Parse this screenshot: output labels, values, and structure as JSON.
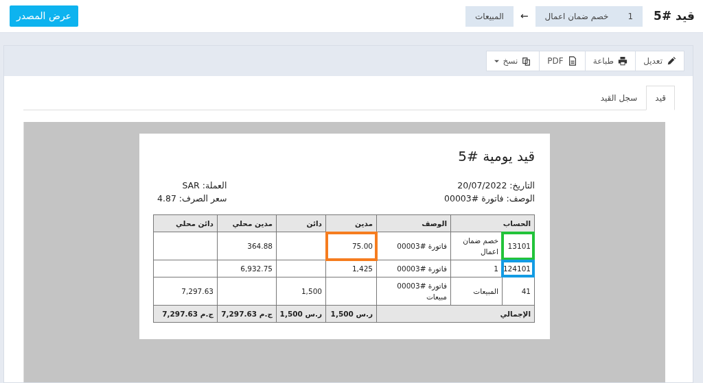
{
  "header": {
    "title": "قيد #5",
    "breadcrumb": [
      {
        "kind": "chip",
        "text": "1"
      },
      {
        "kind": "chip",
        "text": "خصم ضمان اعمال"
      },
      {
        "kind": "arrow",
        "text": "←"
      },
      {
        "kind": "chip",
        "text": "المبيعات"
      }
    ],
    "source_button": "عرض المصدر"
  },
  "toolbar": [
    {
      "kind": "edit",
      "label": "تعديل",
      "dropdown": false
    },
    {
      "kind": "print",
      "label": "طباعة",
      "dropdown": false
    },
    {
      "kind": "pdf",
      "label": "PDF",
      "dropdown": false
    },
    {
      "kind": "copy",
      "label": "نسخ",
      "dropdown": true
    }
  ],
  "tabs": [
    {
      "label": "قيد",
      "selected": true
    },
    {
      "label": "سجل القيد",
      "selected": false
    }
  ],
  "document": {
    "title": "قيد يومية #5",
    "info_right": [
      "التاريخ: 20/07/2022",
      "الوصف: فاتورة #00003"
    ],
    "info_left": [
      "العملة: SAR",
      "سعر الصرف: 4.87"
    ],
    "columns": [
      "الحساب",
      "الوصف",
      "مدين",
      "دائن",
      "مدين محلي",
      "دائن محلي"
    ],
    "rows": [
      {
        "cells": [
          {
            "kind": "account",
            "number": "13101",
            "color": "#22c33a",
            "name": "خصم ضمان اعمال"
          },
          {
            "text": "فاتورة #00003"
          },
          {
            "text": "75.00",
            "color": "#f57c1f"
          },
          {
            "text": null
          },
          {
            "text": "364.88"
          },
          {
            "text": null
          }
        ]
      },
      {
        "cells": [
          {
            "kind": "account",
            "number": "124101",
            "color": "#139be3",
            "name": "1"
          },
          {
            "text": "فاتورة #00003"
          },
          {
            "text": "1,425"
          },
          {
            "text": null
          },
          {
            "text": "6,932.75"
          },
          {
            "text": null
          }
        ]
      },
      {
        "cells": [
          {
            "kind": "account",
            "number": "41",
            "name": "المبيعات"
          },
          {
            "text": "فاتورة #00003 مبيعات"
          },
          {
            "text": null
          },
          {
            "text": "1,500"
          },
          {
            "text": null
          },
          {
            "text": "7,297.63"
          }
        ]
      }
    ],
    "totals": {
      "label": "الإجمالي",
      "values": [
        "ر.س 1,500",
        "ر.س 1,500",
        "ج.م 7,297.63",
        "ج.م 7,297.63"
      ]
    }
  }
}
